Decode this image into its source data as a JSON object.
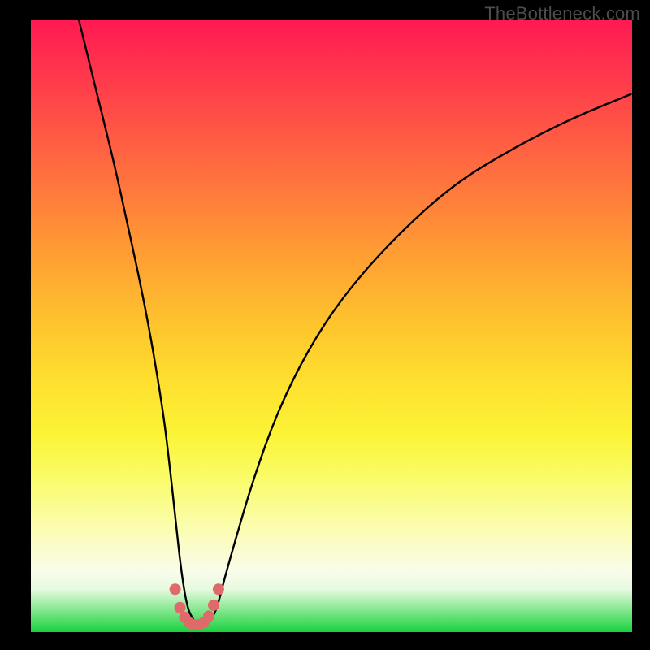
{
  "watermark": "TheBottleneck.com",
  "chart_data": {
    "type": "line",
    "title": "",
    "xlabel": "",
    "ylabel": "",
    "xlim": [
      0,
      100
    ],
    "ylim": [
      0,
      100
    ],
    "series": [
      {
        "name": "curve",
        "color": "#000000",
        "x": [
          8,
          10,
          12,
          14,
          16,
          18,
          20,
          22,
          23,
          24,
          25,
          26,
          27,
          28,
          29,
          30,
          31,
          32,
          34,
          37,
          41,
          46,
          52,
          60,
          70,
          80,
          90,
          100
        ],
        "y": [
          100,
          92,
          84,
          76,
          67,
          58,
          48,
          36,
          28,
          19,
          10,
          4,
          2,
          1,
          1,
          2,
          4,
          8,
          15,
          25,
          36,
          46,
          55,
          64,
          73,
          79,
          84,
          88
        ]
      }
    ],
    "markers": {
      "name": "valley-markers",
      "color": "#e06a6a",
      "radius_px": 7,
      "x": [
        24.0,
        24.8,
        25.6,
        26.4,
        27.2,
        28.0,
        28.8,
        29.6,
        30.4,
        31.2
      ],
      "y": [
        7.0,
        4.0,
        2.4,
        1.5,
        1.2,
        1.2,
        1.6,
        2.6,
        4.4,
        7.0
      ]
    },
    "gradient_stops": [
      {
        "pos": 0.0,
        "color": "#ff1a52"
      },
      {
        "pos": 0.1,
        "color": "#ff3b4b"
      },
      {
        "pos": 0.25,
        "color": "#ff6f3f"
      },
      {
        "pos": 0.38,
        "color": "#ff9d33"
      },
      {
        "pos": 0.5,
        "color": "#fec52d"
      },
      {
        "pos": 0.6,
        "color": "#fee22f"
      },
      {
        "pos": 0.68,
        "color": "#fbf436"
      },
      {
        "pos": 0.75,
        "color": "#fafc6b"
      },
      {
        "pos": 0.83,
        "color": "#fbfdb0"
      },
      {
        "pos": 0.9,
        "color": "#fafceb"
      },
      {
        "pos": 0.93,
        "color": "#e7fae0"
      },
      {
        "pos": 0.97,
        "color": "#72e47f"
      },
      {
        "pos": 1.0,
        "color": "#19d141"
      }
    ]
  }
}
